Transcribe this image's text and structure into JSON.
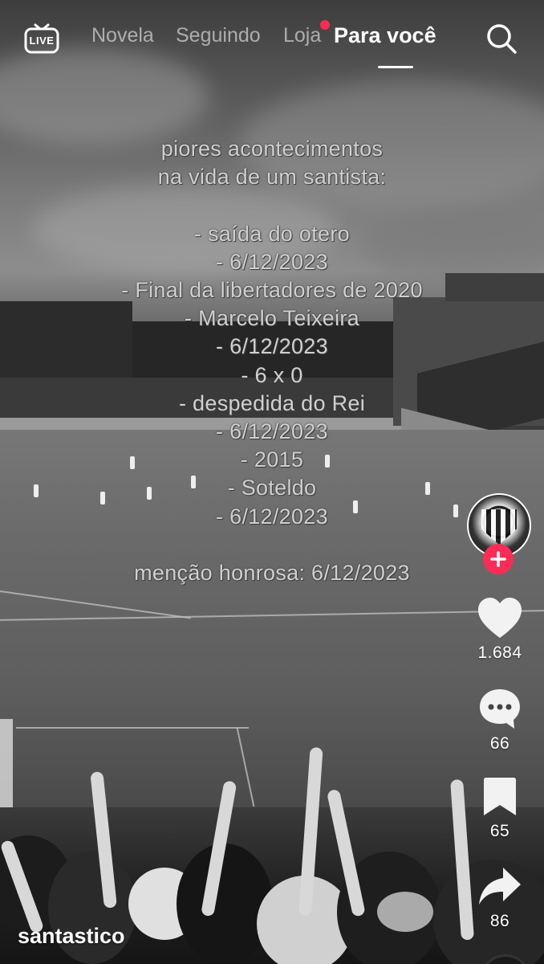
{
  "top_nav": {
    "live_label": "LIVE",
    "tabs": [
      {
        "label": "Novela"
      },
      {
        "label": "Seguindo"
      },
      {
        "label": "Loja",
        "has_notification_dot": true
      },
      {
        "label": "Para você",
        "active": true
      }
    ]
  },
  "overlay": {
    "lines": [
      "piores acontecimentos",
      "na vida de um santista:",
      "",
      "- saída do otero",
      "- 6/12/2023",
      "- Final da libertadores de 2020",
      "- Marcelo Teixeira",
      "- 6/12/2023",
      "- 6 x 0",
      "- despedida do Rei",
      "- 6/12/2023",
      "- 2015",
      "- Soteldo",
      "- 6/12/2023",
      "",
      "menção honrosa: 6/12/2023"
    ]
  },
  "actions": {
    "likes": "1.684",
    "comments": "66",
    "saves": "65",
    "shares": "86"
  },
  "author": {
    "username": "santastico"
  },
  "colors": {
    "accent_red": "#fe2c55",
    "text_white": "#ffffff"
  }
}
